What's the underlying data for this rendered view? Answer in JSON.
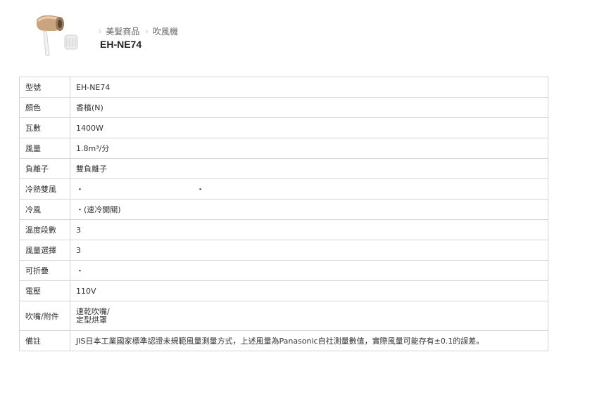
{
  "breadcrumb": {
    "items": [
      "美髮商品",
      "吹風機"
    ]
  },
  "product": {
    "title": "EH-NE74",
    "image_icon": "hair-dryer-icon"
  },
  "specs": [
    {
      "label": "型號",
      "value": "EH-NE74"
    },
    {
      "label": "顏色",
      "value": "香檳(N)"
    },
    {
      "label": "瓦數",
      "value": "1400W"
    },
    {
      "label": "風量",
      "value": "1.8m³/分"
    },
    {
      "label": "負離子",
      "value": "雙負離子"
    },
    {
      "label": "冷熱雙風",
      "value": "・",
      "value2": "・"
    },
    {
      "label": "冷風",
      "value": "・(速冷開關)"
    },
    {
      "label": "溫度段數",
      "value": "3"
    },
    {
      "label": "風量選擇",
      "value": "3"
    },
    {
      "label": "可折疊",
      "value": "・"
    },
    {
      "label": "電壓",
      "value": "110V"
    },
    {
      "label": "吹嘴/附件",
      "value_lines": [
        "速乾吹嘴/",
        "定型烘罩"
      ]
    },
    {
      "label": "備註",
      "value": "JIS日本工業國家標準認證未規範風量測量方式，上述風量為Panasonic自社測量數值，實際風量可能存有±0.1的誤差。"
    }
  ]
}
